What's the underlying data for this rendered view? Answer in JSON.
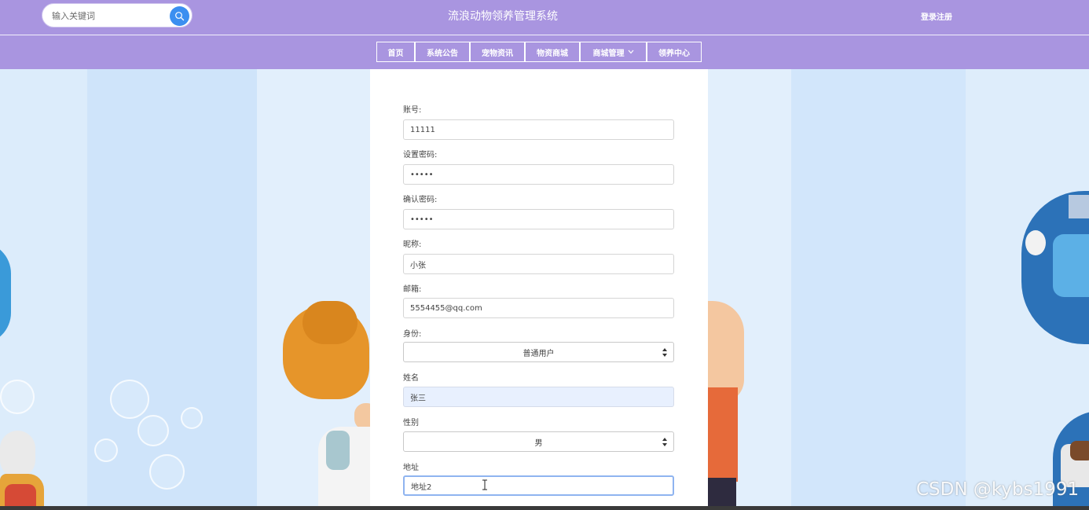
{
  "header": {
    "search_placeholder": "输入关键词",
    "site_title": "流浪动物领养管理系统",
    "login_label": "登录注册"
  },
  "nav": {
    "items": [
      {
        "label": "首页"
      },
      {
        "label": "系统公告"
      },
      {
        "label": "宠物资讯"
      },
      {
        "label": "物资商城"
      },
      {
        "label": "商城管理"
      },
      {
        "label": "领养中心"
      }
    ]
  },
  "form": {
    "account": {
      "label": "账号:",
      "value": "11111"
    },
    "password": {
      "label": "设置密码:",
      "value": "•••••"
    },
    "confirm": {
      "label": "确认密码:",
      "value": "•••••"
    },
    "nickname": {
      "label": "昵称:",
      "value": "小张"
    },
    "email": {
      "label": "邮箱:",
      "value": "5554455@qq.com"
    },
    "role": {
      "label": "身份:",
      "value": "普通用户"
    },
    "name": {
      "label": "姓名",
      "value": "张三"
    },
    "gender": {
      "label": "性别",
      "value": "男"
    },
    "address": {
      "label": "地址",
      "value": "地址2"
    }
  },
  "watermark": "CSDN @kybs1991",
  "colors": {
    "header_bg": "#a995e0",
    "search_button": "#3b8ff0",
    "page_bg": "#e3effc"
  }
}
